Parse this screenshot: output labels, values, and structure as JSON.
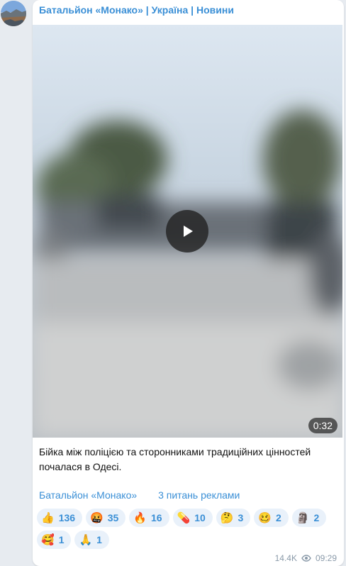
{
  "channel": {
    "name": "Батальйон «Монако» | Україна | Новини"
  },
  "video": {
    "duration": "0:32",
    "play_icon": "play-icon"
  },
  "post": {
    "caption": "Бійка між поліцією та сторонниками традиційних цінностей почалася в Одесі."
  },
  "links": {
    "first": "Батальйон «Монако»",
    "second": "3 питань реклами"
  },
  "reactions": [
    {
      "emoji": "👍",
      "count": "136"
    },
    {
      "emoji": "🤬",
      "count": "35"
    },
    {
      "emoji": "🔥",
      "count": "16"
    },
    {
      "emoji": "💊",
      "count": "10"
    },
    {
      "emoji": "🤔",
      "count": "3"
    },
    {
      "emoji": "🥴",
      "count": "2"
    },
    {
      "emoji": "🗿",
      "count": "2"
    },
    {
      "emoji": "🥰",
      "count": "1"
    },
    {
      "emoji": "🙏",
      "count": "1"
    }
  ],
  "meta": {
    "views": "14.4K",
    "time": "09:29"
  },
  "colors": {
    "accent": "#3a8fd6",
    "reaction_bg": "#e9f1fa",
    "background": "#e7ebf0"
  }
}
